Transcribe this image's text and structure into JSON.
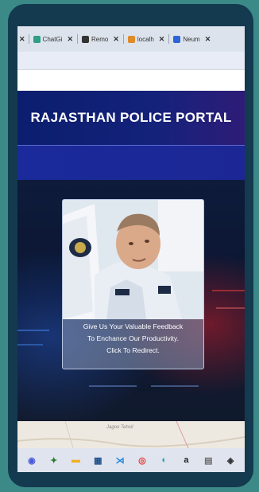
{
  "browser": {
    "tabs": [
      {
        "label": "ChatGi",
        "favicon_color": "#2f9e86"
      },
      {
        "label": "Remo",
        "favicon_color": "#333333"
      },
      {
        "label": "localh",
        "favicon_color": "#e08a2a"
      },
      {
        "label": "Neum",
        "favicon_color": "#2f63d8"
      }
    ],
    "close_glyph": "✕"
  },
  "page": {
    "title": "RAJASTHAN POLICE PORTAL",
    "feedback_card": {
      "line1": "Give Us Your Valuable Feedback",
      "line2": "To Enchance Our Productivity.",
      "line3": "Click To Redirect."
    },
    "map_label": "Jagoo Tehsil"
  },
  "taskbar": {
    "icons": [
      {
        "name": "chat-icon",
        "glyph": "◉",
        "color": "#4a5bd8"
      },
      {
        "name": "store-icon",
        "glyph": "✦",
        "color": "#2e7d32"
      },
      {
        "name": "folder-icon",
        "glyph": "▬",
        "color": "#f2b01e"
      },
      {
        "name": "calculator-icon",
        "glyph": "▦",
        "color": "#1f4e8c"
      },
      {
        "name": "vscode-icon",
        "glyph": "⋊",
        "color": "#1e88e5"
      },
      {
        "name": "chrome-icon",
        "glyph": "◎",
        "color": "#e53935"
      },
      {
        "name": "edge-icon",
        "glyph": "◐",
        "color": "#1aa3a3"
      },
      {
        "name": "amazon-icon",
        "glyph": "a",
        "color": "#222222"
      },
      {
        "name": "notepad-icon",
        "glyph": "▤",
        "color": "#6d6d6d"
      },
      {
        "name": "media-icon",
        "glyph": "◈",
        "color": "#333333"
      }
    ]
  }
}
